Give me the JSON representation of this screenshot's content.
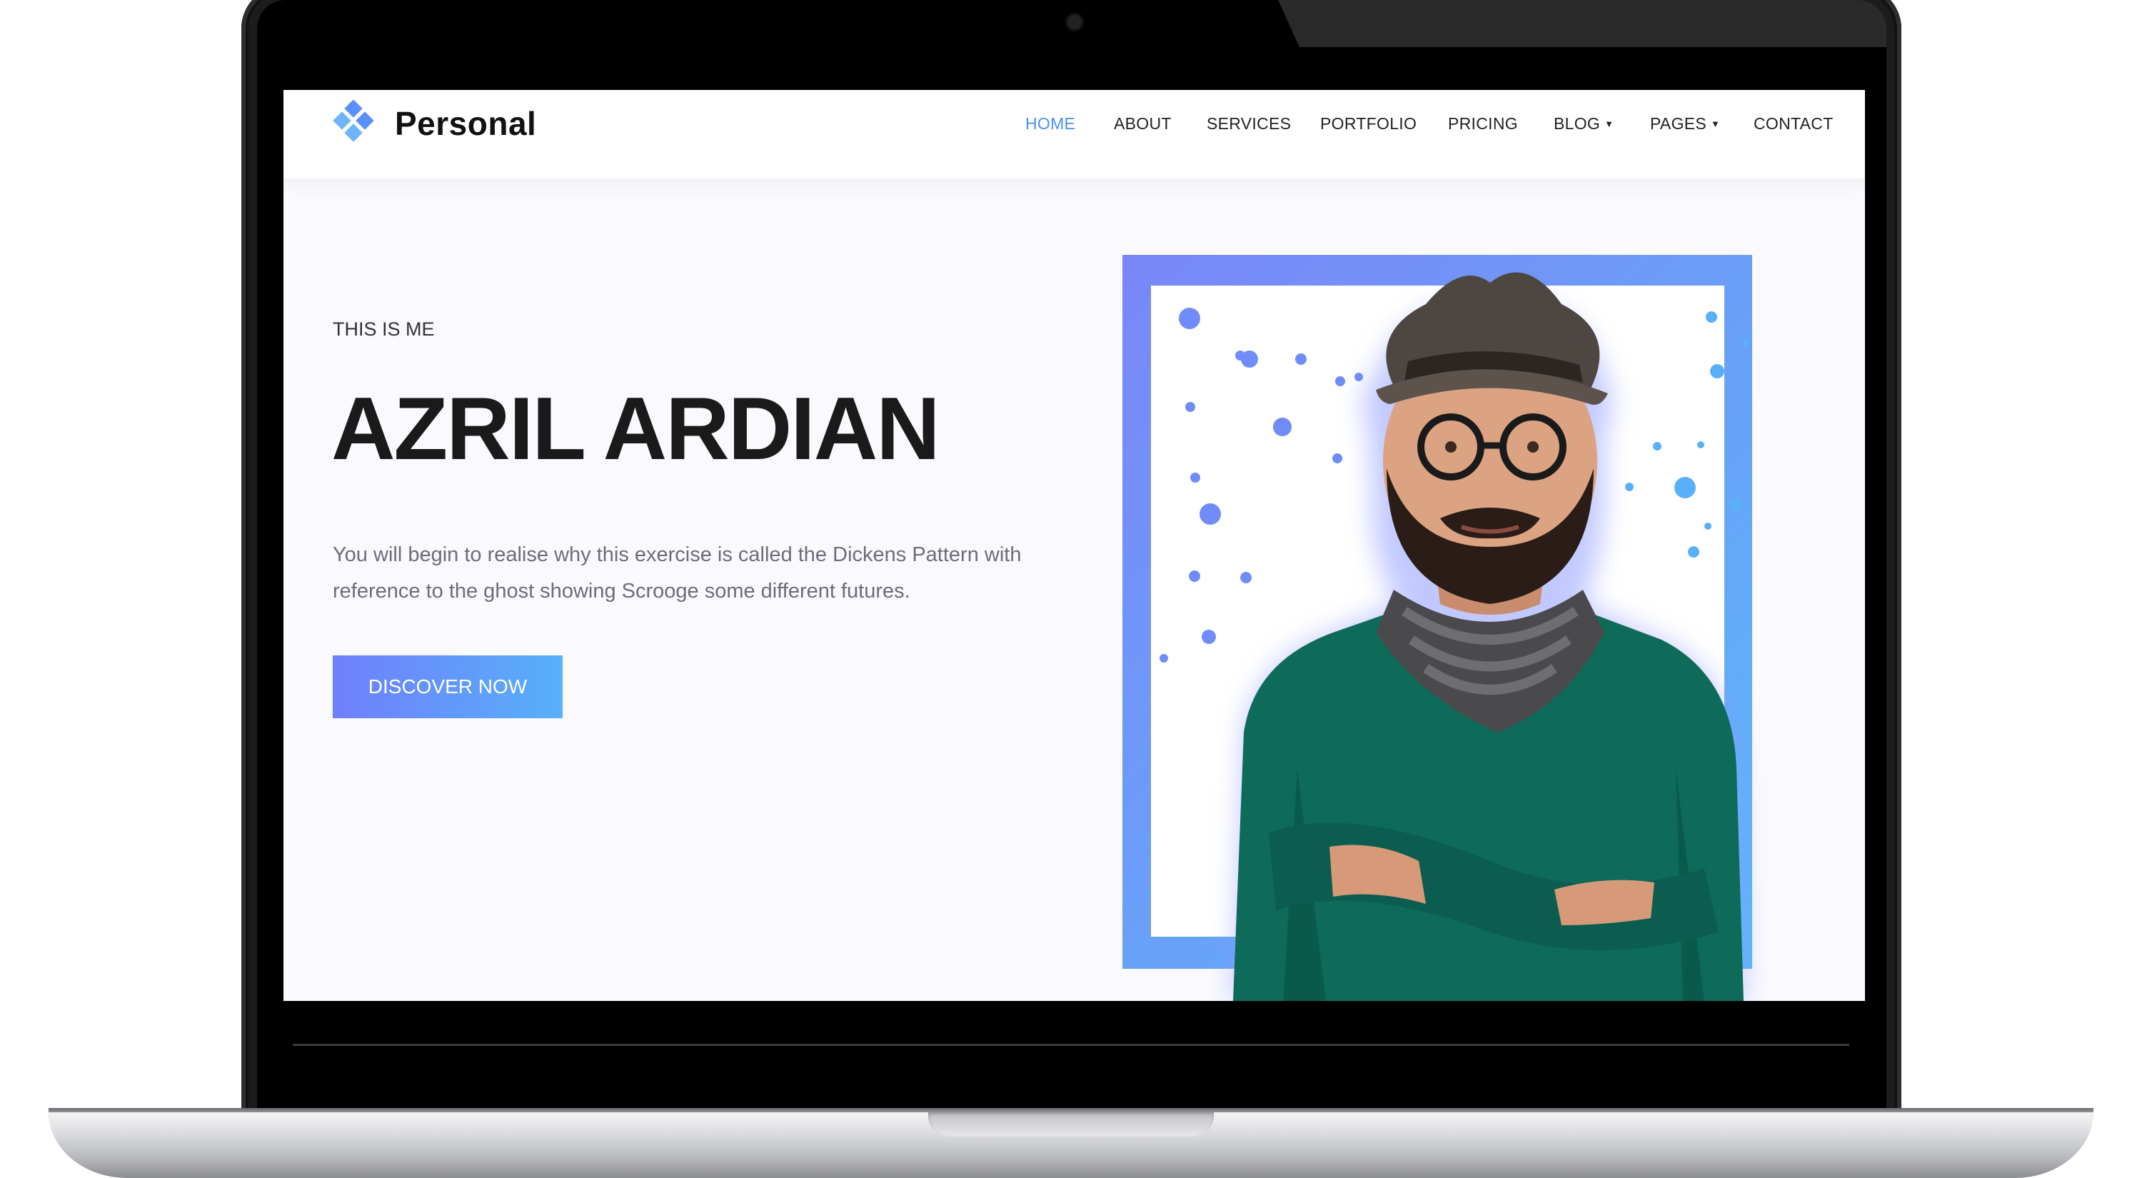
{
  "brand": {
    "name": "Personal",
    "logo_icon": "diamond-cluster-icon",
    "logo_colors": [
      "#5b8ff9",
      "#6fb4fb"
    ]
  },
  "nav": {
    "items": [
      {
        "label": "HOME",
        "active": true
      },
      {
        "label": "ABOUT"
      },
      {
        "label": "SERVICES"
      },
      {
        "label": "PORTFOLIO"
      },
      {
        "label": "PRICING"
      },
      {
        "label": "BLOG",
        "dropdown": true
      },
      {
        "label": "PAGES",
        "dropdown": true
      },
      {
        "label": "CONTACT"
      }
    ]
  },
  "hero": {
    "kicker": "THIS IS ME",
    "title": "AZRIL ARDIAN",
    "description": "You will begin to realise why this exercise is called the Dickens Pattern with reference to the ghost showing Scrooge some different futures.",
    "cta_label": "DISCOVER NOW"
  },
  "colors": {
    "accent": "#4c8ef5",
    "gradient_start": "#6f7ffb",
    "gradient_end": "#57b0fa",
    "dot": "#6f8cf8"
  }
}
